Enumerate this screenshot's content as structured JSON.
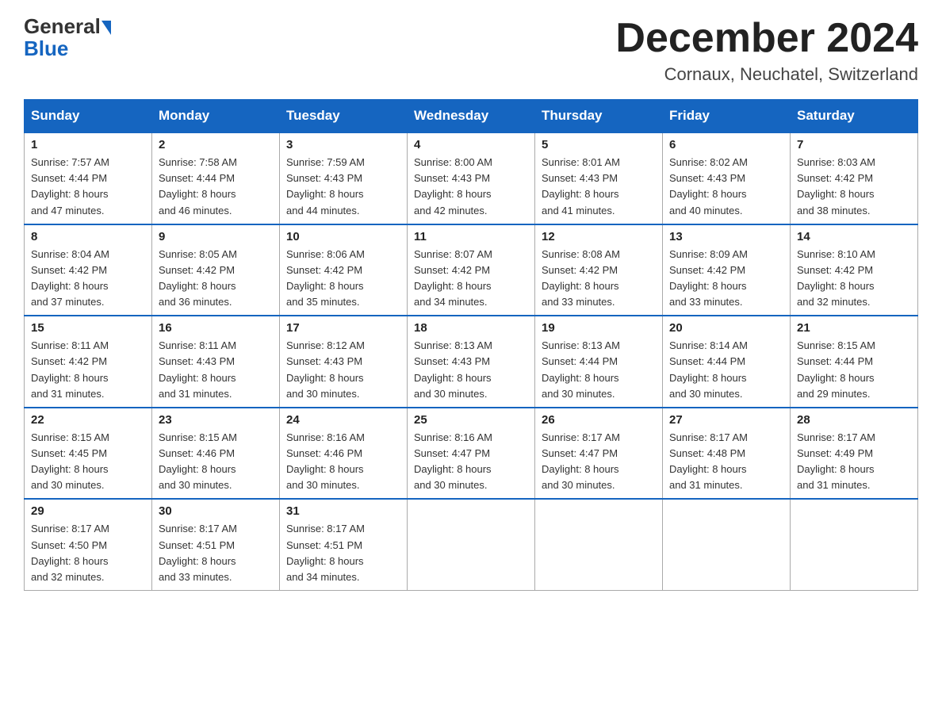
{
  "header": {
    "logo_general": "General",
    "logo_blue": "Blue",
    "month_title": "December 2024",
    "location": "Cornaux, Neuchatel, Switzerland"
  },
  "days_of_week": [
    "Sunday",
    "Monday",
    "Tuesday",
    "Wednesday",
    "Thursday",
    "Friday",
    "Saturday"
  ],
  "weeks": [
    [
      {
        "day": "1",
        "sunrise": "7:57 AM",
        "sunset": "4:44 PM",
        "daylight": "8 hours and 47 minutes."
      },
      {
        "day": "2",
        "sunrise": "7:58 AM",
        "sunset": "4:44 PM",
        "daylight": "8 hours and 46 minutes."
      },
      {
        "day": "3",
        "sunrise": "7:59 AM",
        "sunset": "4:43 PM",
        "daylight": "8 hours and 44 minutes."
      },
      {
        "day": "4",
        "sunrise": "8:00 AM",
        "sunset": "4:43 PM",
        "daylight": "8 hours and 42 minutes."
      },
      {
        "day": "5",
        "sunrise": "8:01 AM",
        "sunset": "4:43 PM",
        "daylight": "8 hours and 41 minutes."
      },
      {
        "day": "6",
        "sunrise": "8:02 AM",
        "sunset": "4:43 PM",
        "daylight": "8 hours and 40 minutes."
      },
      {
        "day": "7",
        "sunrise": "8:03 AM",
        "sunset": "4:42 PM",
        "daylight": "8 hours and 38 minutes."
      }
    ],
    [
      {
        "day": "8",
        "sunrise": "8:04 AM",
        "sunset": "4:42 PM",
        "daylight": "8 hours and 37 minutes."
      },
      {
        "day": "9",
        "sunrise": "8:05 AM",
        "sunset": "4:42 PM",
        "daylight": "8 hours and 36 minutes."
      },
      {
        "day": "10",
        "sunrise": "8:06 AM",
        "sunset": "4:42 PM",
        "daylight": "8 hours and 35 minutes."
      },
      {
        "day": "11",
        "sunrise": "8:07 AM",
        "sunset": "4:42 PM",
        "daylight": "8 hours and 34 minutes."
      },
      {
        "day": "12",
        "sunrise": "8:08 AM",
        "sunset": "4:42 PM",
        "daylight": "8 hours and 33 minutes."
      },
      {
        "day": "13",
        "sunrise": "8:09 AM",
        "sunset": "4:42 PM",
        "daylight": "8 hours and 33 minutes."
      },
      {
        "day": "14",
        "sunrise": "8:10 AM",
        "sunset": "4:42 PM",
        "daylight": "8 hours and 32 minutes."
      }
    ],
    [
      {
        "day": "15",
        "sunrise": "8:11 AM",
        "sunset": "4:42 PM",
        "daylight": "8 hours and 31 minutes."
      },
      {
        "day": "16",
        "sunrise": "8:11 AM",
        "sunset": "4:43 PM",
        "daylight": "8 hours and 31 minutes."
      },
      {
        "day": "17",
        "sunrise": "8:12 AM",
        "sunset": "4:43 PM",
        "daylight": "8 hours and 30 minutes."
      },
      {
        "day": "18",
        "sunrise": "8:13 AM",
        "sunset": "4:43 PM",
        "daylight": "8 hours and 30 minutes."
      },
      {
        "day": "19",
        "sunrise": "8:13 AM",
        "sunset": "4:44 PM",
        "daylight": "8 hours and 30 minutes."
      },
      {
        "day": "20",
        "sunrise": "8:14 AM",
        "sunset": "4:44 PM",
        "daylight": "8 hours and 30 minutes."
      },
      {
        "day": "21",
        "sunrise": "8:15 AM",
        "sunset": "4:44 PM",
        "daylight": "8 hours and 29 minutes."
      }
    ],
    [
      {
        "day": "22",
        "sunrise": "8:15 AM",
        "sunset": "4:45 PM",
        "daylight": "8 hours and 30 minutes."
      },
      {
        "day": "23",
        "sunrise": "8:15 AM",
        "sunset": "4:46 PM",
        "daylight": "8 hours and 30 minutes."
      },
      {
        "day": "24",
        "sunrise": "8:16 AM",
        "sunset": "4:46 PM",
        "daylight": "8 hours and 30 minutes."
      },
      {
        "day": "25",
        "sunrise": "8:16 AM",
        "sunset": "4:47 PM",
        "daylight": "8 hours and 30 minutes."
      },
      {
        "day": "26",
        "sunrise": "8:17 AM",
        "sunset": "4:47 PM",
        "daylight": "8 hours and 30 minutes."
      },
      {
        "day": "27",
        "sunrise": "8:17 AM",
        "sunset": "4:48 PM",
        "daylight": "8 hours and 31 minutes."
      },
      {
        "day": "28",
        "sunrise": "8:17 AM",
        "sunset": "4:49 PM",
        "daylight": "8 hours and 31 minutes."
      }
    ],
    [
      {
        "day": "29",
        "sunrise": "8:17 AM",
        "sunset": "4:50 PM",
        "daylight": "8 hours and 32 minutes."
      },
      {
        "day": "30",
        "sunrise": "8:17 AM",
        "sunset": "4:51 PM",
        "daylight": "8 hours and 33 minutes."
      },
      {
        "day": "31",
        "sunrise": "8:17 AM",
        "sunset": "4:51 PM",
        "daylight": "8 hours and 34 minutes."
      },
      null,
      null,
      null,
      null
    ]
  ],
  "labels": {
    "sunrise": "Sunrise: ",
    "sunset": "Sunset: ",
    "daylight": "Daylight: "
  }
}
